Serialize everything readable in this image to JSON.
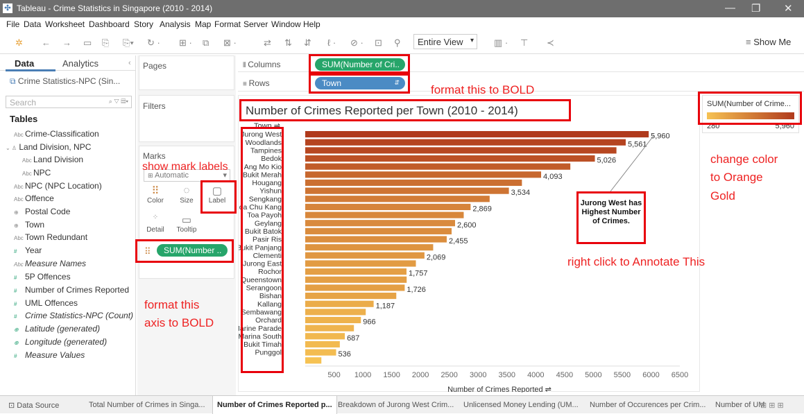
{
  "window": {
    "title": "Tableau - Crime Statistics in Singapore (2010 - 2014)"
  },
  "menu": [
    "File",
    "Data",
    "Worksheet",
    "Dashboard",
    "Story",
    "Analysis",
    "Map",
    "Format",
    "Server",
    "Window",
    "Help"
  ],
  "toolbar": {
    "fit_label": "Entire View",
    "show_me_label": "Show Me"
  },
  "left_pane": {
    "tab_data": "Data",
    "tab_analytics": "Analytics",
    "datasource": "Crime Statistics-NPC (Sin...",
    "search_placeholder": "Search",
    "tables_heading": "Tables",
    "fields": [
      {
        "name": "Crime-Classification",
        "type": "Abc"
      },
      {
        "name": "Land Division, NPC",
        "type": "hier"
      },
      {
        "name": "Land Division",
        "type": "Abc"
      },
      {
        "name": "NPC",
        "type": "Abc"
      },
      {
        "name": "NPC (NPC Location)",
        "type": "Abc"
      },
      {
        "name": "Offence",
        "type": "Abc"
      },
      {
        "name": "Postal Code",
        "type": "geo"
      },
      {
        "name": "Town",
        "type": "geo"
      },
      {
        "name": "Town Redundant",
        "type": "Abc"
      },
      {
        "name": "Year",
        "type": "#"
      },
      {
        "name": "Measure Names",
        "type": "Abc"
      },
      {
        "name": "5P Offences",
        "type": "#"
      },
      {
        "name": "Number of Crimes Reported",
        "type": "#"
      },
      {
        "name": "UML Offences",
        "type": "#"
      },
      {
        "name": "Crime Statistics-NPC (Count)",
        "type": "#"
      },
      {
        "name": "Latitude (generated)",
        "type": "geo"
      },
      {
        "name": "Longitude (generated)",
        "type": "geo"
      },
      {
        "name": "Measure Values",
        "type": "#"
      }
    ]
  },
  "cards": {
    "pages": "Pages",
    "filters": "Filters",
    "marks": "Marks",
    "mark_type": "Automatic",
    "color": "Color",
    "size": "Size",
    "label": "Label",
    "detail": "Detail",
    "tooltip": "Tooltip",
    "marks_pill": "SUM(Number .."
  },
  "shelves": {
    "columns_label": "Columns",
    "rows_label": "Rows",
    "columns_pill": "SUM(Number of Cri..",
    "rows_pill": "Town"
  },
  "legend": {
    "title": "SUM(Number of Crime...",
    "min": "280",
    "max": "5,960"
  },
  "annotations": {
    "bold_title": "format this to BOLD",
    "mark_labels": "show mark labels",
    "orange_gold_1": "change color",
    "orange_gold_2": "to Orange",
    "orange_gold_3": "Gold",
    "annotate": "right click to Annotate This",
    "axis_bold_1": "format this",
    "axis_bold_2": "axis to BOLD",
    "callout": "Jurong West has Highest Number of Crimes."
  },
  "chart_data": {
    "type": "bar",
    "orientation": "horizontal",
    "title": "Number of Crimes Reported per Town (2010 - 2014)",
    "ylabel": "Town",
    "xlabel": "Number of Crimes Reported",
    "xlim": [
      0,
      6500
    ],
    "xticks": [
      500,
      1000,
      1500,
      2000,
      2500,
      3000,
      3500,
      4000,
      4500,
      5000,
      5500,
      6000,
      6500
    ],
    "categories": [
      "Jurong West",
      "Woodlands",
      "Tampines",
      "Bedok",
      "Ang Mo Kio",
      "Bukit Merah",
      "Hougang",
      "Yishun",
      "Sengkang",
      "Choa Chu Kang",
      "Toa Payoh",
      "Geylang",
      "Bukit Batok",
      "Pasir Ris",
      "Bukit Panjang",
      "Clementi",
      "Jurong East",
      "Rochor",
      "Queenstown",
      "Serangoon",
      "Bishan",
      "Kallang",
      "Sembawang",
      "Orchard",
      "Marine Parade",
      "Marina South",
      "Bukit Timah",
      "Punggol"
    ],
    "values": [
      5960,
      5561,
      5400,
      5026,
      4600,
      4093,
      3760,
      3534,
      3200,
      2869,
      2750,
      2600,
      2540,
      2455,
      2220,
      2069,
      1920,
      1757,
      1760,
      1726,
      1580,
      1187,
      1050,
      966,
      845,
      687,
      600,
      536,
      280
    ],
    "labels": {
      "Jurong West": "5,960",
      "Woodlands": "5,561",
      "Bedok": "5,026",
      "Bukit Merah": "4,093",
      "Yishun": "3,534",
      "Choa Chu Kang": "2,869",
      "Geylang": "2,600",
      "Pasir Ris": "2,455",
      "Clementi": "2,069",
      "Rochor": "1,757",
      "Serangoon": "1,726",
      "Kallang": "1,187",
      "Orchard": "966",
      "Marina South": "687",
      "Punggol": "536"
    },
    "color_low": "#f6c253",
    "color_high": "#b03a1c",
    "grid": false
  },
  "bottom_tabs": [
    "Data Source",
    "Total Number of Crimes in Singa...",
    "Number of Crimes Reported p...",
    "Breakdown of Jurong West Crim...",
    "Unlicensed Money Lending (UM...",
    "Number of Occurences per Crim...",
    "Number of UM"
  ],
  "active_tab_index": 2
}
